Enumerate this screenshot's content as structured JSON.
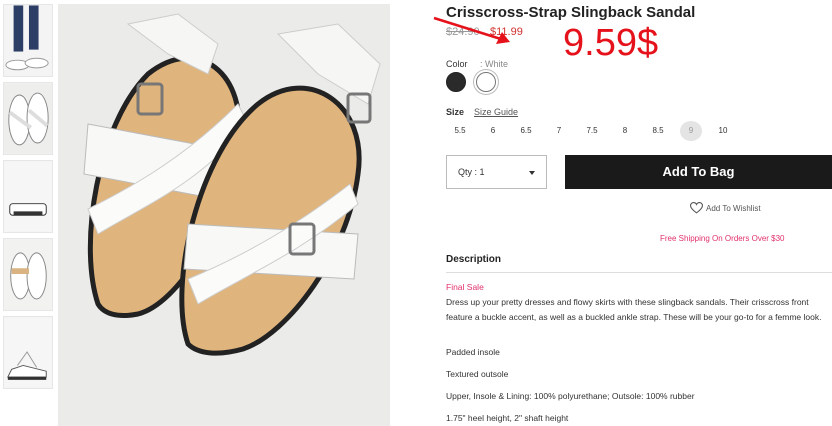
{
  "product": {
    "title": "Crisscross-Strap Slingback Sandal",
    "price_original": "$24.90",
    "price_sale": "$11.99",
    "annotation_price": "9.59$",
    "annotation_color": "#e5121b"
  },
  "color": {
    "label": "Color",
    "separator": ":",
    "value": "White",
    "swatches": [
      "black",
      "white"
    ]
  },
  "size": {
    "label": "Size",
    "guide_link": "Size Guide",
    "options": [
      "5.5",
      "6",
      "6.5",
      "7",
      "7.5",
      "8",
      "8.5",
      "9",
      "10"
    ],
    "selected": "9"
  },
  "quantity": {
    "label": "Qty : 1"
  },
  "actions": {
    "add_to_bag": "Add To Bag",
    "wishlist": "Add To Wishlist"
  },
  "promo": {
    "free_shipping": "Free Shipping On Orders Over $30"
  },
  "description": {
    "heading": "Description",
    "final_sale": "Final Sale",
    "body": "Dress up your pretty dresses and flowy skirts with these slingback sandals. Their crisscross front feature a buckle accent, as well as a buckled ankle strap. These will be your go-to for a femme look.",
    "details": [
      "Padded insole",
      "Textured outsole",
      "Upper, Insole & Lining: 100% polyurethane; Outsole: 100% rubber",
      "1.75\" heel height, 2\" shaft height"
    ]
  },
  "colors": {
    "accent_pink": "#e0306c",
    "sale_red": "#d0312d",
    "button_bg": "#1a1a1a"
  }
}
